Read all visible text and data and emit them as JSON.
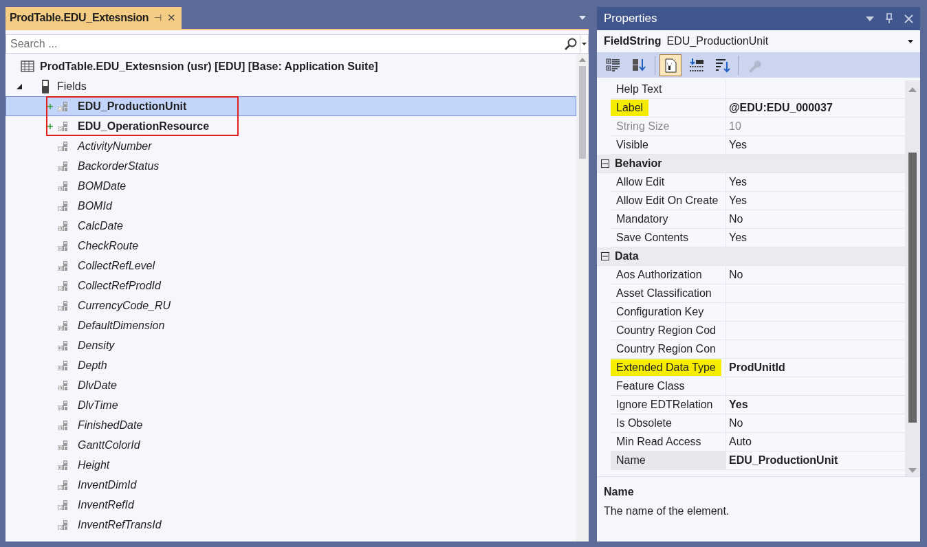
{
  "document_tab": {
    "title": "ProdTable.EDU_Extesnsion",
    "pin_glyph": "⊣",
    "close_glyph": "✕"
  },
  "search": {
    "placeholder": "Search ..."
  },
  "tree": {
    "label": "ProdTable.EDU_Extesnsion (usr) [EDU] [Base: Application Suite]",
    "children": [
      {
        "label": "Fields",
        "expanded": true,
        "children": [
          {
            "label": "EDU_ProductionUnit",
            "kind": "string",
            "added": true,
            "selected": true,
            "highlighted": true
          },
          {
            "label": "EDU_OperationResource",
            "kind": "string",
            "added": true,
            "selected": false,
            "highlighted": true
          },
          {
            "label": "ActivityNumber",
            "kind": "string",
            "added": false,
            "selected": false,
            "highlighted": false
          },
          {
            "label": "BackorderStatus",
            "kind": "enum",
            "added": false,
            "selected": false,
            "highlighted": false
          },
          {
            "label": "BOMDate",
            "kind": "date",
            "added": false,
            "selected": false,
            "highlighted": false
          },
          {
            "label": "BOMId",
            "kind": "string",
            "added": false,
            "selected": false,
            "highlighted": false
          },
          {
            "label": "CalcDate",
            "kind": "date",
            "added": false,
            "selected": false,
            "highlighted": false
          },
          {
            "label": "CheckRoute",
            "kind": "enum",
            "added": false,
            "selected": false,
            "highlighted": false
          },
          {
            "label": "CollectRefLevel",
            "kind": "int",
            "added": false,
            "selected": false,
            "highlighted": false
          },
          {
            "label": "CollectRefProdId",
            "kind": "string",
            "added": false,
            "selected": false,
            "highlighted": false
          },
          {
            "label": "CurrencyCode_RU",
            "kind": "string",
            "added": false,
            "selected": false,
            "highlighted": false
          },
          {
            "label": "DefaultDimension",
            "kind": "int",
            "added": false,
            "selected": false,
            "highlighted": false
          },
          {
            "label": "Density",
            "kind": "real",
            "added": false,
            "selected": false,
            "highlighted": false
          },
          {
            "label": "Depth",
            "kind": "real",
            "added": false,
            "selected": false,
            "highlighted": false
          },
          {
            "label": "DlvDate",
            "kind": "date",
            "added": false,
            "selected": false,
            "highlighted": false
          },
          {
            "label": "DlvTime",
            "kind": "time",
            "added": false,
            "selected": false,
            "highlighted": false
          },
          {
            "label": "FinishedDate",
            "kind": "date",
            "added": false,
            "selected": false,
            "highlighted": false
          },
          {
            "label": "GanttColorId",
            "kind": "int",
            "added": false,
            "selected": false,
            "highlighted": false
          },
          {
            "label": "Height",
            "kind": "real",
            "added": false,
            "selected": false,
            "highlighted": false
          },
          {
            "label": "InventDimId",
            "kind": "string",
            "added": false,
            "selected": false,
            "highlighted": false
          },
          {
            "label": "InventRefId",
            "kind": "string",
            "added": false,
            "selected": false,
            "highlighted": false
          },
          {
            "label": "InventRefTransId",
            "kind": "string",
            "added": false,
            "selected": false,
            "highlighted": false
          }
        ]
      }
    ]
  },
  "properties": {
    "title": "Properties",
    "object_type": "FieldString",
    "object_name": "EDU_ProductionUnit",
    "toolbar": [
      {
        "kind": "categorized",
        "selected": false,
        "disabled": false
      },
      {
        "kind": "alphabetical",
        "selected": false,
        "disabled": false
      },
      {
        "kind": "properties",
        "selected": true,
        "disabled": false
      },
      {
        "kind": "expand",
        "selected": false,
        "disabled": false
      },
      {
        "kind": "sort",
        "selected": false,
        "disabled": false
      },
      {
        "kind": "wrench",
        "selected": false,
        "disabled": true
      }
    ],
    "rows": [
      {
        "kind": "property",
        "name": "Help Text",
        "selected": false,
        "highlighted": false,
        "disabled": false
      },
      {
        "kind": "property",
        "name": "Label",
        "value": "@EDU:EDU_000037",
        "selected": false,
        "highlighted": true,
        "disabled": false,
        "modified": true
      },
      {
        "kind": "property",
        "name": "String Size",
        "value": "10",
        "selected": false,
        "highlighted": false,
        "disabled": true,
        "modified": false
      },
      {
        "kind": "property",
        "name": "Visible",
        "value": "Yes",
        "selected": false,
        "highlighted": false,
        "disabled": false,
        "modified": false
      },
      {
        "kind": "category",
        "name": "Behavior",
        "expanded": true
      },
      {
        "kind": "property",
        "name": "Allow Edit",
        "value": "Yes",
        "selected": false,
        "highlighted": false,
        "disabled": false,
        "modified": false
      },
      {
        "kind": "property",
        "name": "Allow Edit On Create",
        "value": "Yes",
        "selected": false,
        "highlighted": false,
        "disabled": false,
        "modified": false
      },
      {
        "kind": "property",
        "name": "Mandatory",
        "value": "No",
        "selected": false,
        "highlighted": false,
        "disabled": false,
        "modified": false
      },
      {
        "kind": "property",
        "name": "Save Contents",
        "value": "Yes",
        "selected": false,
        "highlighted": false,
        "disabled": false,
        "modified": false
      },
      {
        "kind": "category",
        "name": "Data",
        "expanded": true
      },
      {
        "kind": "property",
        "name": "Aos Authorization",
        "value": "No",
        "selected": false,
        "highlighted": false,
        "disabled": false,
        "modified": false
      },
      {
        "kind": "property",
        "name": "Asset Classification",
        "selected": false,
        "highlighted": false,
        "disabled": false
      },
      {
        "kind": "property",
        "name": "Configuration Key",
        "selected": false,
        "highlighted": false,
        "disabled": false
      },
      {
        "kind": "property",
        "name": "Country Region Cod",
        "selected": false,
        "highlighted": false,
        "disabled": false
      },
      {
        "kind": "property",
        "name": "Country Region Con",
        "selected": false,
        "highlighted": false,
        "disabled": false
      },
      {
        "kind": "property",
        "name": "Extended Data Type",
        "value": "ProdUnitId",
        "selected": false,
        "highlighted": true,
        "disabled": false,
        "modified": true
      },
      {
        "kind": "property",
        "name": "Feature Class",
        "selected": false,
        "highlighted": false,
        "disabled": false
      },
      {
        "kind": "property",
        "name": "Ignore EDTRelation",
        "value": "Yes",
        "selected": false,
        "highlighted": false,
        "disabled": false,
        "modified": true
      },
      {
        "kind": "property",
        "name": "Is Obsolete",
        "value": "No",
        "selected": false,
        "highlighted": false,
        "disabled": false,
        "modified": false
      },
      {
        "kind": "property",
        "name": "Min Read Access",
        "value": "Auto",
        "selected": false,
        "highlighted": false,
        "disabled": false,
        "modified": false
      },
      {
        "kind": "property",
        "name": "Name",
        "value": "EDU_ProductionUnit",
        "selected": true,
        "highlighted": false,
        "disabled": false,
        "modified": true
      }
    ],
    "description": {
      "title": "Name",
      "text": "The name of the element."
    }
  }
}
